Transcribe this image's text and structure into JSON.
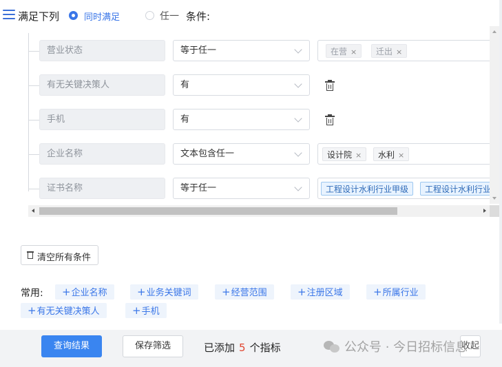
{
  "header": {
    "title": "满足下列",
    "mode_all_label": "同时满足",
    "mode_any_label": "任一",
    "conditions_label": "条件:"
  },
  "rows": [
    {
      "field": "营业状态",
      "operator": "等于任一",
      "tags": [
        "在营",
        "迁出"
      ]
    },
    {
      "field": "有无关键决策人",
      "operator": "有"
    },
    {
      "field": "手机",
      "operator": "有"
    },
    {
      "field": "企业名称",
      "operator": "文本包含任一",
      "tags": [
        "设计院",
        "水利"
      ]
    },
    {
      "field": "证书名称",
      "operator": "等于任一",
      "tags": [
        "工程设计水利行业甲级",
        "工程设计水利行业"
      ]
    }
  ],
  "tag_remove_glyph": "×",
  "clear_button": "清空所有条件",
  "common": {
    "label": "常用:",
    "plus": "+",
    "chips": [
      "企业名称",
      "业务关键词",
      "经营范围",
      "注册区域",
      "所属行业",
      "有无关键决策人",
      "手机"
    ]
  },
  "footer": {
    "query_button": "查询结果",
    "save_button": "保存筛选",
    "added_prefix": "已添加",
    "added_count": "5",
    "added_suffix": "个指标",
    "collapse_button": "收起",
    "watermark": "公众号 · 今日招标信息"
  },
  "colors": {
    "accent": "#3a76e8",
    "count": "#e0452f"
  }
}
